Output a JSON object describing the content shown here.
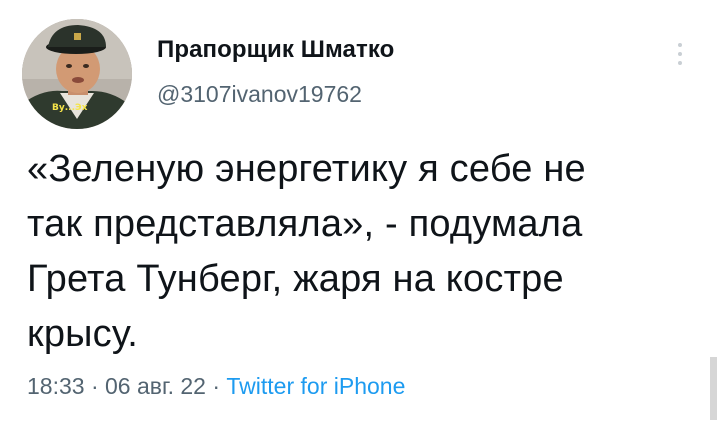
{
  "author": {
    "name": "Прапорщик Шматко",
    "handle": "@3107ivanov19762",
    "avatar_icon": "profile-photo",
    "avatar_caption": "Ву...Эх"
  },
  "more_icon": "vertical-ellipsis-icon",
  "tweet": {
    "lines": [
      "«Зеленую энергетику я себе не",
      "так представляла», - подумала",
      "Грета Тунберг, жаря на костре",
      "крысу."
    ]
  },
  "meta": {
    "time": "18:33",
    "separator": " · ",
    "date": "06 авг. 22",
    "source": "Twitter for iPhone"
  },
  "colors": {
    "text": "#0f1419",
    "secondary": "#536471",
    "link": "#1d9bf0"
  }
}
